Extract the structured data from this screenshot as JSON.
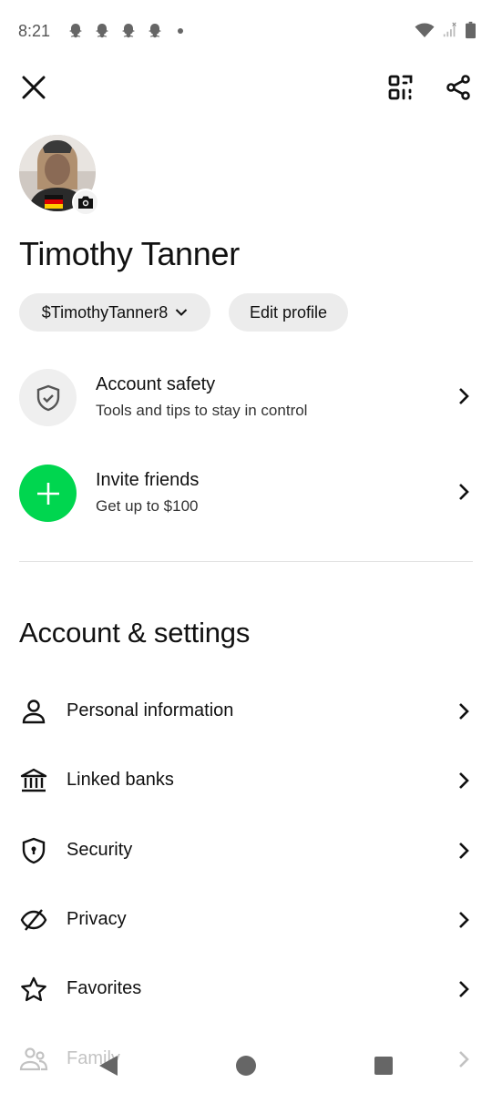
{
  "status_bar": {
    "time": "8:21",
    "notification_icons": [
      "snapchat-ghost-icon",
      "snapchat-ghost-icon",
      "snapchat-ghost-icon",
      "snapchat-ghost-icon"
    ],
    "right_icons": [
      "wifi-icon",
      "signal-icon",
      "battery-icon"
    ]
  },
  "header": {
    "icons": [
      "close-icon",
      "qr-code-icon",
      "share-icon"
    ]
  },
  "profile": {
    "name": "Timothy Tanner",
    "cashtag": "$TimothyTanner8",
    "edit_label": "Edit profile"
  },
  "features": [
    {
      "title": "Account safety",
      "subtitle": "Tools and tips to stay in control",
      "icon": "shield-check-icon",
      "icon_bg": "#efefef"
    },
    {
      "title": "Invite friends",
      "subtitle": "Get up to $100",
      "icon": "plus-icon",
      "icon_bg": "#00d64f"
    }
  ],
  "settings": {
    "title": "Account & settings",
    "items": [
      {
        "label": "Personal information",
        "icon": "person-icon"
      },
      {
        "label": "Linked banks",
        "icon": "bank-icon"
      },
      {
        "label": "Security",
        "icon": "shield-lock-icon"
      },
      {
        "label": "Privacy",
        "icon": "eye-off-icon"
      },
      {
        "label": "Favorites",
        "icon": "star-icon"
      },
      {
        "label": "Family",
        "icon": "family-icon"
      }
    ]
  },
  "nav_bar": {
    "icons": [
      "back-icon",
      "home-icon",
      "recents-icon"
    ]
  },
  "colors": {
    "accent_green": "#00d64f",
    "chip_bg": "#ececec",
    "text": "#111111"
  }
}
